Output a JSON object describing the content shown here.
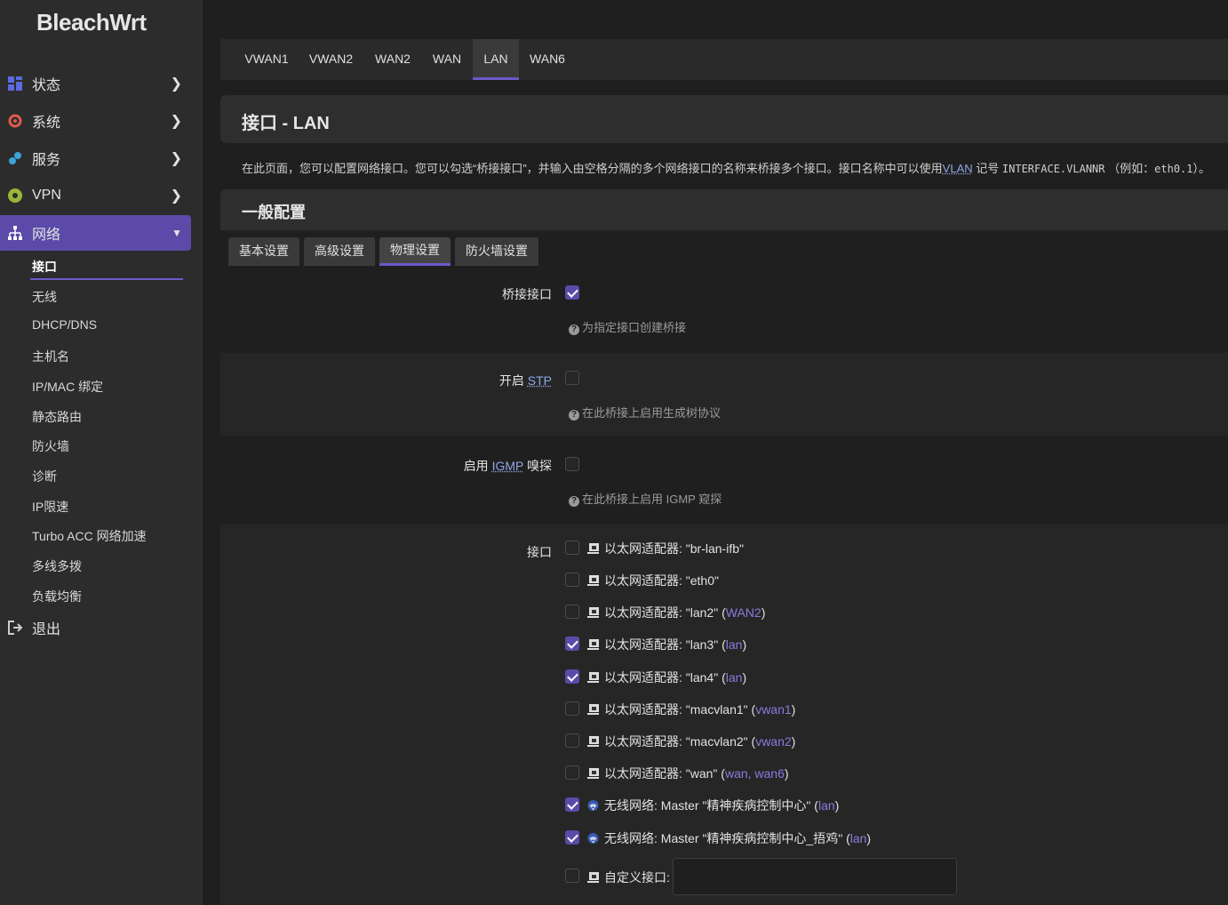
{
  "brand": "BleachWrt",
  "sidebar": {
    "menu": [
      {
        "label": "状态",
        "icon": "dashboard-icon"
      },
      {
        "label": "系统",
        "icon": "gear-icon"
      },
      {
        "label": "服务",
        "icon": "services-icon"
      },
      {
        "label": "VPN",
        "icon": "vpn-icon"
      },
      {
        "label": "网络",
        "icon": "network-icon"
      }
    ],
    "submenu": [
      "接口",
      "无线",
      "DHCP/DNS",
      "主机名",
      "IP/MAC 绑定",
      "静态路由",
      "防火墙",
      "诊断",
      "IP限速",
      "Turbo ACC 网络加速",
      "多线多拨",
      "负载均衡"
    ],
    "logout": "退出"
  },
  "tabs": [
    "VWAN1",
    "VWAN2",
    "WAN2",
    "WAN",
    "LAN",
    "WAN6"
  ],
  "active_tab": "LAN",
  "page_title": "接口 - LAN",
  "description": {
    "part1": "在此页面，您可以配置网络接口。您可以勾选“桥接接口”，并输入由空格分隔的多个网络接口的名称来桥接多个接口。接口名称中可以使用",
    "vlan": "VLAN",
    "part2": "记号",
    "code1": "INTERFACE.VLANNR",
    "part3": "（例如：",
    "code2": "eth0.1",
    "part4": "）。"
  },
  "section_title": "一般配置",
  "subtabs": [
    "基本设置",
    "高级设置",
    "物理设置",
    "防火墙设置"
  ],
  "active_subtab": "物理设置",
  "bridge": {
    "label": "桥接接口",
    "checked": true,
    "hint": "为指定接口创建桥接"
  },
  "stp": {
    "label_prefix": "开启",
    "abbr": "STP",
    "checked": false,
    "hint": "在此桥接上启用生成树协议"
  },
  "igmp": {
    "label_prefix": "启用",
    "abbr": "IGMP",
    "label_suffix": "嗅探",
    "checked": false,
    "hint": "在此桥接上启用 IGMP 窥探"
  },
  "interfaces_label": "接口",
  "interfaces": [
    {
      "text": "以太网适配器: \"br-lan-ifb\"",
      "nets": "",
      "checked": false,
      "icon": "ethernet-icon"
    },
    {
      "text": "以太网适配器: \"eth0\"",
      "nets": "",
      "checked": false,
      "icon": "ethernet-icon"
    },
    {
      "text": "以太网适配器: \"lan2\" (",
      "nets": "WAN2",
      "close": ")",
      "checked": false,
      "icon": "ethernet-icon"
    },
    {
      "text": "以太网适配器: \"lan3\" (",
      "nets": "lan",
      "close": ")",
      "checked": true,
      "icon": "ethernet-icon"
    },
    {
      "text": "以太网适配器: \"lan4\" (",
      "nets": "lan",
      "close": ")",
      "checked": true,
      "icon": "ethernet-icon"
    },
    {
      "text": "以太网适配器: \"macvlan1\" (",
      "nets": "vwan1",
      "close": ")",
      "checked": false,
      "icon": "ethernet-icon"
    },
    {
      "text": "以太网适配器: \"macvlan2\" (",
      "nets": "vwan2",
      "close": ")",
      "checked": false,
      "icon": "ethernet-icon"
    },
    {
      "text": "以太网适配器: \"wan\" (",
      "nets": "wan, wan6",
      "close": ")",
      "checked": false,
      "icon": "ethernet-icon"
    },
    {
      "text": "无线网络: Master \"精神疾病控制中心\" (",
      "nets": "lan",
      "close": ")",
      "checked": true,
      "icon": "wifi-icon"
    },
    {
      "text": "无线网络: Master \"精神疾病控制中心_捂鸡\" (",
      "nets": "lan",
      "close": ")",
      "checked": true,
      "icon": "wifi-icon"
    }
  ],
  "custom": {
    "label": "自定义接口:",
    "value": "",
    "checked": false
  },
  "colors": {
    "accent": "#5b4aa8",
    "link": "#8a7be0",
    "background": "#1f1f1f",
    "sidebar": "#2c2c2c"
  }
}
